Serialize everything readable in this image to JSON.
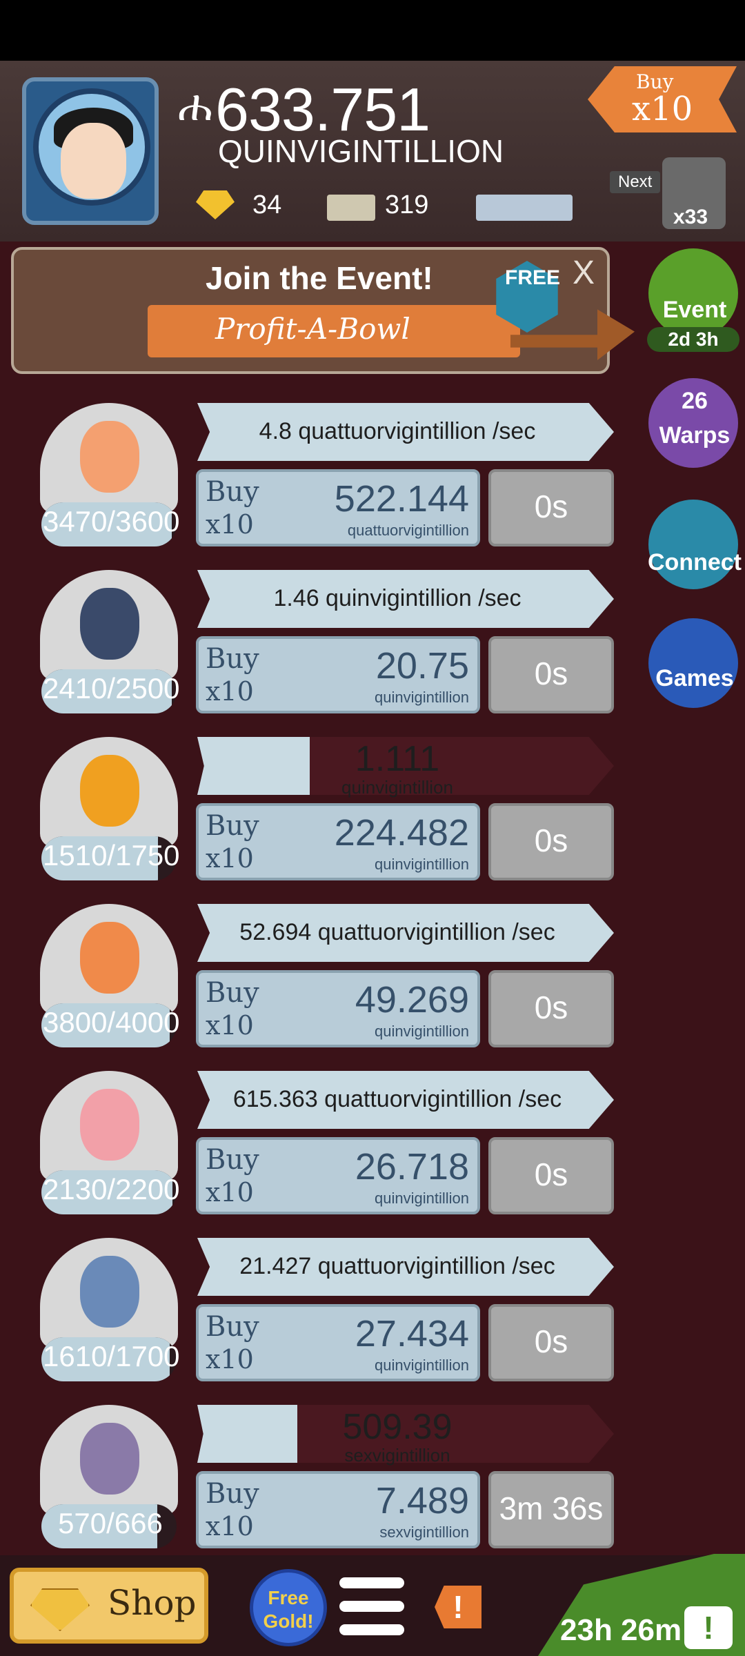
{
  "header": {
    "money_symbol": "ሐ",
    "money": "633.751",
    "money_unit": "QUINVIGINTILLION",
    "gold": "34",
    "mega_bucks": "319",
    "buy_label_1": "Buy",
    "buy_label_2": "x10",
    "next_label": "Next",
    "next_count": "x33"
  },
  "event_banner": {
    "title": "Join the Event!",
    "subtitle": "Profit-A-Bowl",
    "free": "FREE",
    "close": "X"
  },
  "side_buttons": {
    "event": "Event",
    "event_timer": "2d 3h",
    "warps_count": "26",
    "warps": "Warps",
    "connect": "Connect",
    "games": "Games"
  },
  "rows": [
    {
      "count": "3470/3600",
      "progress": 0.964,
      "rate": "4.8 quattuorvigintillion /sec",
      "running": false,
      "buy": "Buy",
      "mult": "x10",
      "cost": "522.144",
      "cost_unit": "quattuorvigintillion",
      "time": "0s"
    },
    {
      "count": "2410/2500",
      "progress": 0.964,
      "rate": "1.46 quinvigintillion /sec",
      "running": false,
      "buy": "Buy",
      "mult": "x10",
      "cost": "20.75",
      "cost_unit": "quinvigintillion",
      "time": "0s"
    },
    {
      "count": "1510/1750",
      "progress": 0.863,
      "rate": "1.111",
      "rate_unit": "quinvigintillion",
      "running": true,
      "run_progress": 0.27,
      "buy": "Buy",
      "mult": "x10",
      "cost": "224.482",
      "cost_unit": "quinvigintillion",
      "time": "0s"
    },
    {
      "count": "3800/4000",
      "progress": 0.95,
      "rate": "52.694 quattuorvigintillion /sec",
      "running": false,
      "buy": "Buy",
      "mult": "x10",
      "cost": "49.269",
      "cost_unit": "quinvigintillion",
      "time": "0s"
    },
    {
      "count": "2130/2200",
      "progress": 0.968,
      "rate": "615.363 quattuorvigintillion /sec",
      "running": false,
      "buy": "Buy",
      "mult": "x10",
      "cost": "26.718",
      "cost_unit": "quinvigintillion",
      "time": "0s"
    },
    {
      "count": "1610/1700",
      "progress": 0.947,
      "rate": "21.427 quattuorvigintillion /sec",
      "running": false,
      "buy": "Buy",
      "mult": "x10",
      "cost": "27.434",
      "cost_unit": "quinvigintillion",
      "time": "0s"
    },
    {
      "count": "570/666",
      "progress": 0.856,
      "rate": "509.39",
      "rate_unit": "sexvigintillion",
      "running": true,
      "run_progress": 0.24,
      "buy": "Buy",
      "mult": "x10",
      "cost": "7.489",
      "cost_unit": "sexvigintillion",
      "time": "3m 36s"
    }
  ],
  "bottom_bar": {
    "shop": "Shop",
    "free_gold_1": "Free",
    "free_gold_2": "Gold!",
    "alert": "!",
    "timer": "23h 26m",
    "tv": "!"
  },
  "colors": {
    "background": "#3b1218",
    "bar_light": "#c9dbe3",
    "bar_dark": "#4a1820",
    "event_green": "#4a8c2a",
    "gold": "#f2c12e",
    "accent_orange": "#e8833a"
  }
}
